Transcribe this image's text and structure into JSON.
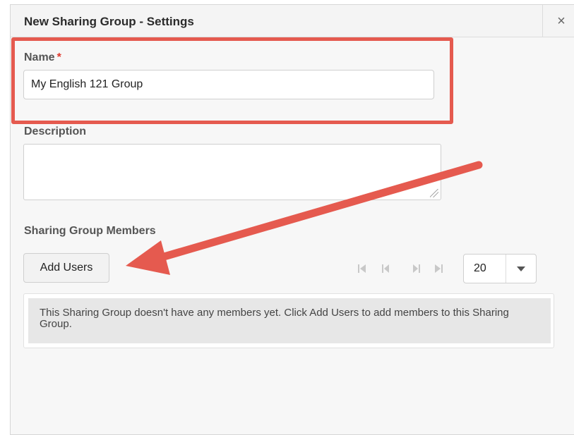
{
  "dialog": {
    "title": "New Sharing Group - Settings",
    "close_glyph": "×"
  },
  "name_field": {
    "label": "Name",
    "required_marker": "*",
    "value": "My English 121 Group"
  },
  "description_field": {
    "label": "Description",
    "value": ""
  },
  "members": {
    "heading": "Sharing Group Members",
    "add_users_label": "Add Users",
    "page_size": "20",
    "empty_message": "This Sharing Group doesn't have any members yet. Click Add Users to add members to this Sharing Group."
  },
  "icons": {
    "first_page": "first-page-icon",
    "prev_page": "prev-page-icon",
    "next_page": "next-page-icon",
    "last_page": "last-page-icon"
  },
  "colors": {
    "annotation": "#e55a4f",
    "required": "#e03a2f",
    "pager_disabled": "#c8c8c8"
  }
}
